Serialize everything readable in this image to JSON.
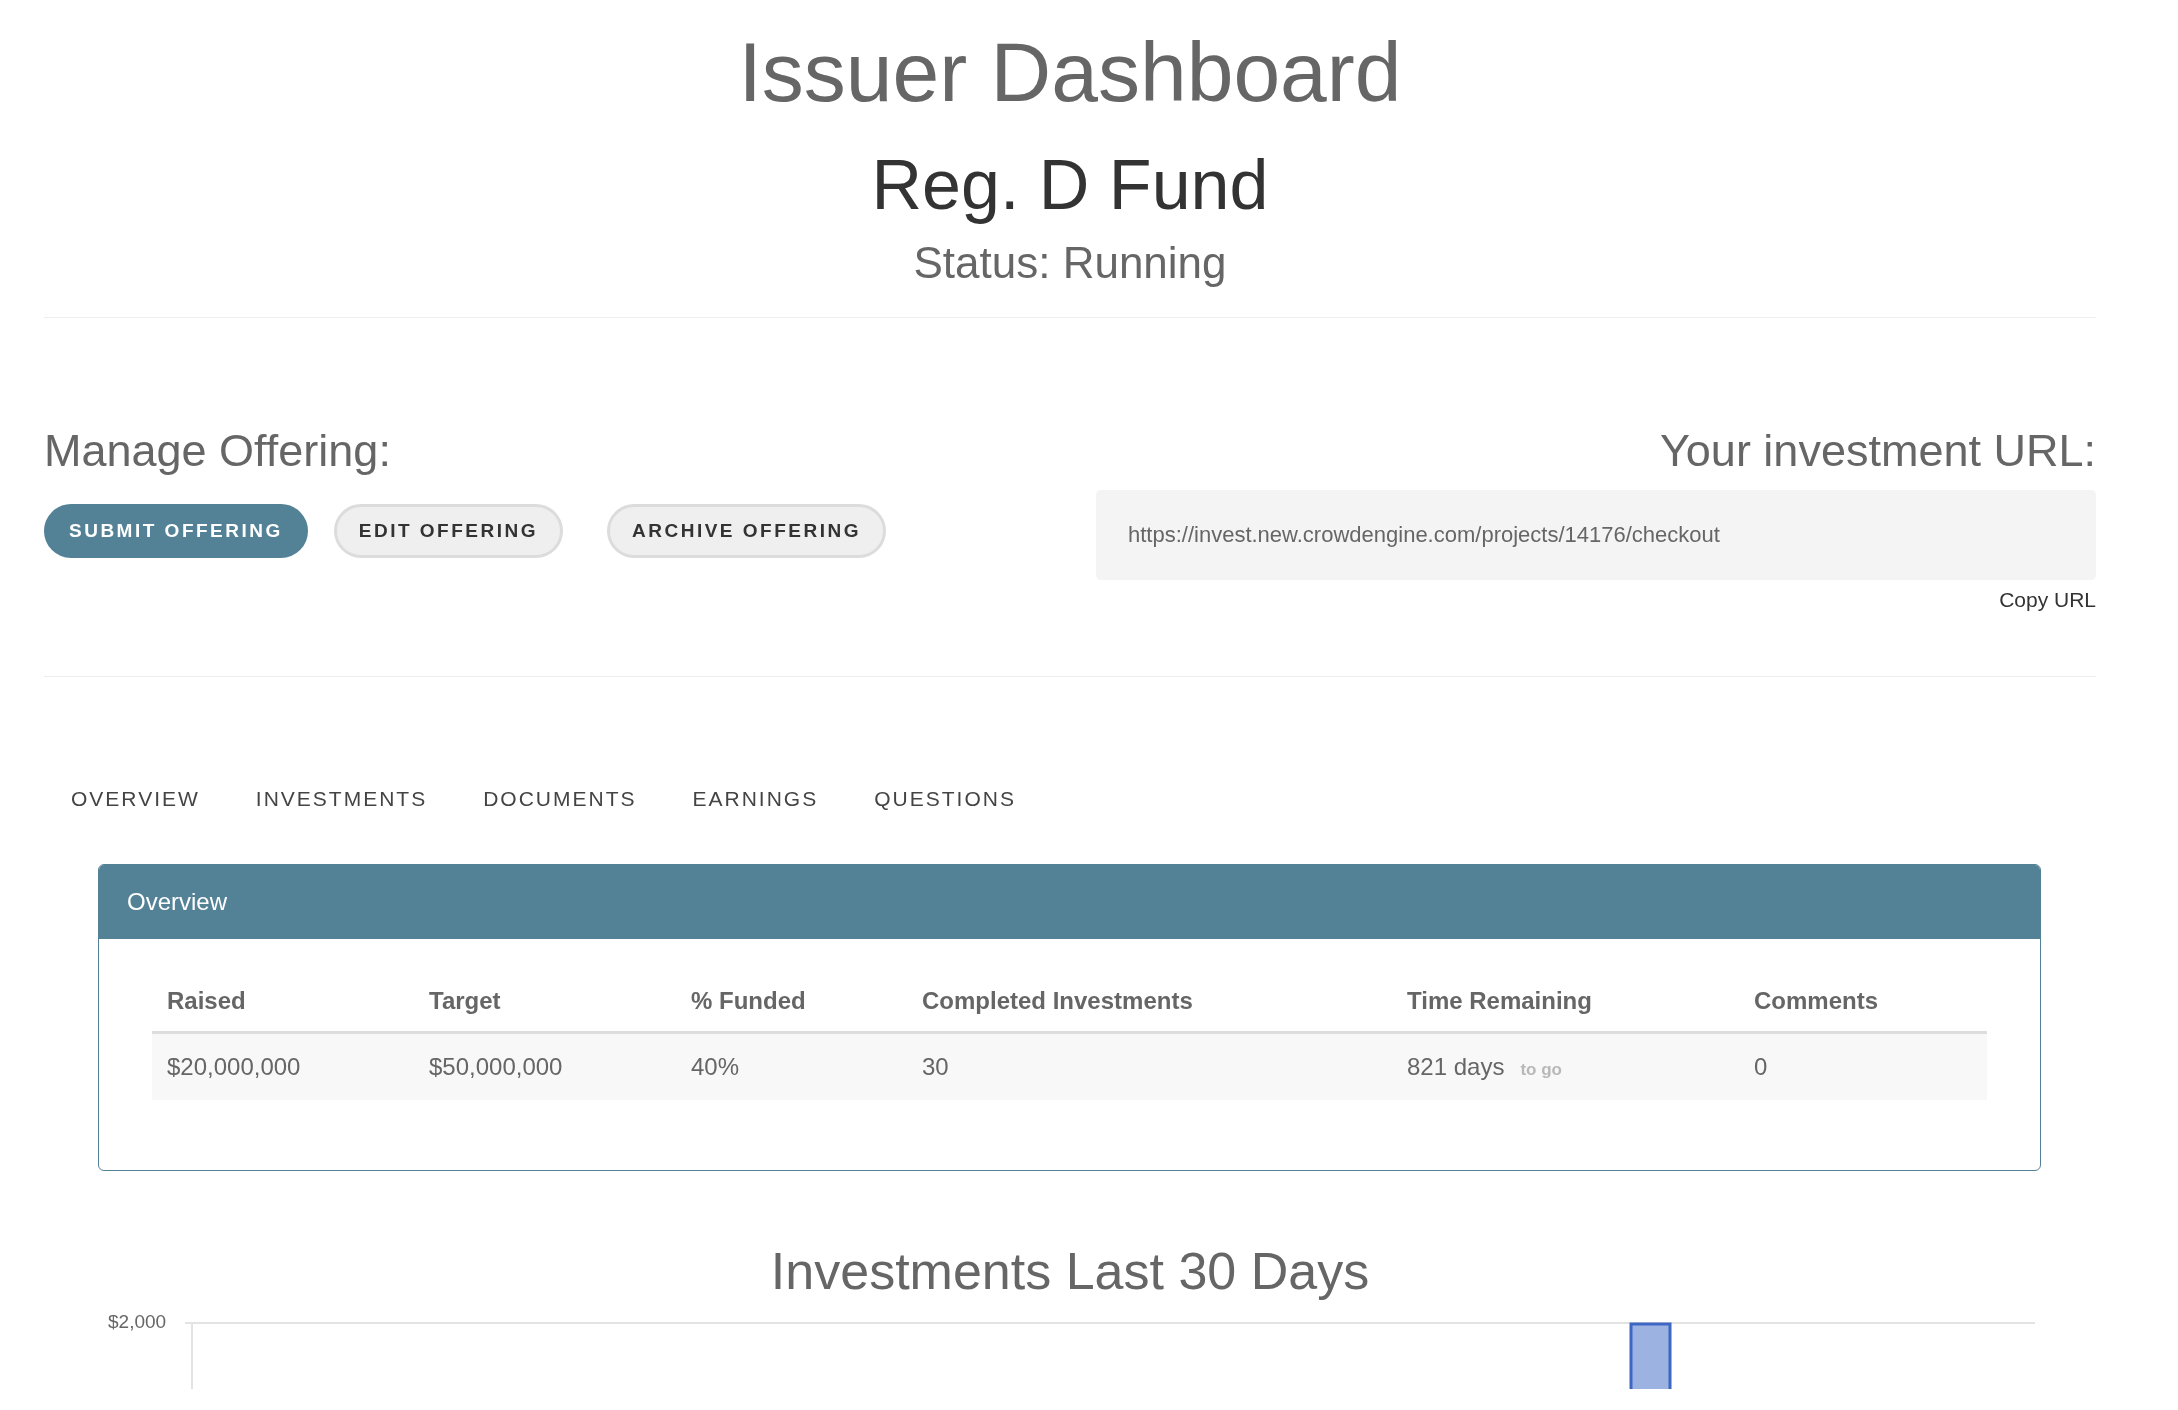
{
  "page_title": "Issuer Dashboard",
  "offering_name": "Reg. D Fund",
  "status": "Status: Running",
  "manage": {
    "heading": "Manage Offering:",
    "buttons": [
      {
        "label": "SUBMIT OFFERING",
        "kind": "primary"
      },
      {
        "label": "EDIT OFFERING",
        "kind": "secondary"
      },
      {
        "label": "ARCHIVE OFFERING",
        "kind": "secondary"
      }
    ]
  },
  "investment_url": {
    "heading": "Your investment URL:",
    "value": "https://invest.new.crowdengine.com/projects/14176/checkout",
    "copy_link": "Copy URL"
  },
  "tabs": [
    {
      "label": "OVERVIEW",
      "selected": false
    },
    {
      "label": "INVESTMENTS",
      "selected": false
    },
    {
      "label": "DOCUMENTS",
      "selected": false
    },
    {
      "label": "EARNINGS",
      "selected": false
    },
    {
      "label": "QUESTIONS",
      "selected": false
    }
  ],
  "overview_panel": {
    "title": "Overview",
    "table": {
      "columns": [
        "Raised",
        "Target",
        "% Funded",
        "Completed Investments",
        "Time Remaining",
        "Comments"
      ],
      "rows": [
        [
          {
            "text": "$20,000,000"
          },
          {
            "text": "$50,000,000"
          },
          {
            "text": "40%"
          },
          {
            "text": "30"
          },
          {
            "text": "821 days",
            "suffix": "to go"
          },
          {
            "text": "0"
          }
        ]
      ]
    }
  },
  "chart": {
    "title": "Investments Last 30 Days",
    "y_tick_label": "$2,000"
  }
}
